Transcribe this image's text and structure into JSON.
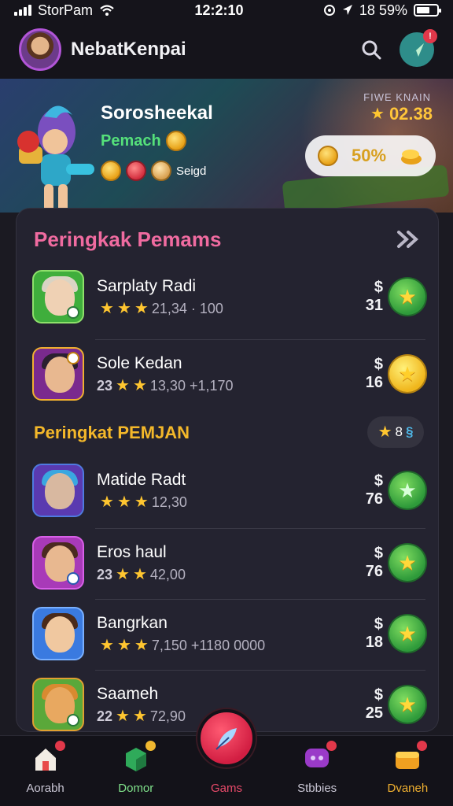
{
  "status_bar": {
    "carrier": "StorPam",
    "time": "12:2:10",
    "battery": "18 59%"
  },
  "header": {
    "title": "NebatKenpai"
  },
  "hero": {
    "name": "Sorosheekal",
    "subtitle": "Pemach",
    "coins_label": "Seigd",
    "right_label": "FIWE KNAIN",
    "right_value": "02.38",
    "pill_value": "50%"
  },
  "section1": {
    "title": "Peringkak Pemams"
  },
  "section2": {
    "title": "Peringkat PEMJAN",
    "pill_value": "8"
  },
  "rows": [
    {
      "name": "Sarplaty Radi",
      "meta_a": "",
      "meta_b": "21,34 · 100",
      "currency": "$",
      "value": "31",
      "btn": "green"
    },
    {
      "name": "Sole Kedan",
      "meta_a": "23",
      "meta_b": "13,30 +1,170",
      "currency": "$",
      "value": "16",
      "btn": "yellow"
    },
    {
      "name": "Matide Radt",
      "meta_a": "",
      "meta_b": "12,30",
      "currency": "$",
      "value": "76",
      "btn": "mint"
    },
    {
      "name": "Eros haul",
      "meta_a": "23",
      "meta_b": "42,00",
      "currency": "$",
      "value": "76",
      "btn": "green"
    },
    {
      "name": "Bangrkan",
      "meta_a": "",
      "meta_b": "7,150 +1180 0000",
      "currency": "$",
      "value": "18",
      "btn": "green"
    },
    {
      "name": "Saameh",
      "meta_a": "22",
      "meta_b": "72,90",
      "currency": "$",
      "value": "25",
      "btn": "green"
    }
  ],
  "nav": [
    {
      "label": "Aorabh"
    },
    {
      "label": "Domor"
    },
    {
      "label": "Gams"
    },
    {
      "label": "Stbbies"
    },
    {
      "label": "Dvaneh"
    }
  ],
  "colors": {
    "accent_pink": "#f06ba0",
    "accent_gold": "#f4b82a",
    "active_nav": "#e84a6a",
    "background": "#1b1a22"
  }
}
